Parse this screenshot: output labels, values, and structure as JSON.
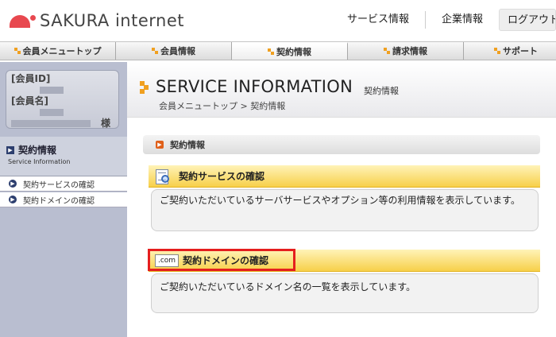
{
  "header": {
    "logo_text": "SAKURA internet",
    "links": [
      "サービス情報",
      "企業情報"
    ],
    "logout_label": "ログアウト"
  },
  "nav": {
    "tabs": [
      "会員メニュートップ",
      "会員情報",
      "契約情報",
      "請求情報",
      "サポート"
    ],
    "active": "契約情報"
  },
  "sidebar": {
    "member_id_label": "[会員ID]",
    "member_name_label": "[会員名]",
    "honorific": "様",
    "section_title": "契約情報",
    "section_subtitle": "Service Information",
    "items": [
      "契約サービスの確認",
      "契約ドメインの確認"
    ]
  },
  "main": {
    "page_title": "SERVICE INFORMATION",
    "page_subtitle": "契約情報",
    "breadcrumb": "会員メニュートップ > 契約情報",
    "section_heading": "契約情報",
    "cards": [
      {
        "icon": "document-magnifier-icon",
        "title": "契約サービスの確認",
        "description": "ご契約いただいているサーバサービスやオプション等の利用情報を表示しています。"
      },
      {
        "icon": "dot-com-icon",
        "icon_text": ".com",
        "title": "契約ドメインの確認",
        "description": "ご契約いただいているドメイン名の一覧を表示しています。"
      }
    ]
  },
  "colors": {
    "brand_red": "#e8484f",
    "accent_orange": "#f0a020",
    "card_yellow": "#f7d04a",
    "sidebar_bg": "#b9bed0",
    "highlight_red": "#e51e1e"
  }
}
